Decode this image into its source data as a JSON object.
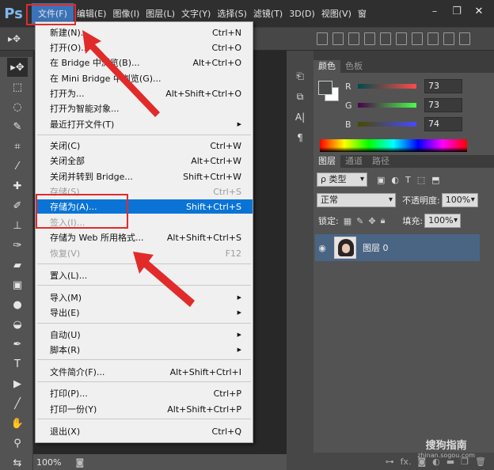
{
  "app": {
    "logo": "Ps"
  },
  "menubar": {
    "items": [
      "文件(F)",
      "编辑(E)",
      "图像(I)",
      "图层(L)",
      "文字(Y)",
      "选择(S)",
      "滤镜(T)",
      "3D(D)",
      "视图(V)",
      "窗"
    ]
  },
  "file_menu": {
    "items": [
      {
        "label": "新建(N)...",
        "shortcut": "Ctrl+N"
      },
      {
        "label": "打开(O)...",
        "shortcut": "Ctrl+O"
      },
      {
        "label": "在 Bridge 中浏览(B)...",
        "shortcut": "Alt+Ctrl+O"
      },
      {
        "label": "在 Mini Bridge 中浏览(G)...",
        "shortcut": ""
      },
      {
        "label": "打开为...",
        "shortcut": "Alt+Shift+Ctrl+O"
      },
      {
        "label": "打开为智能对象...",
        "shortcut": ""
      },
      {
        "label": "最近打开文件(T)",
        "shortcut": ""
      },
      {
        "label": "关闭(C)",
        "shortcut": "Ctrl+W"
      },
      {
        "label": "关闭全部",
        "shortcut": "Alt+Ctrl+W"
      },
      {
        "label": "关闭并转到 Bridge...",
        "shortcut": "Shift+Ctrl+W"
      },
      {
        "label": "存储(S)",
        "shortcut": "Ctrl+S"
      },
      {
        "label": "存储为(A)...",
        "shortcut": "Shift+Ctrl+S"
      },
      {
        "label": "签入(I)...",
        "shortcut": ""
      },
      {
        "label": "存储为 Web 所用格式...",
        "shortcut": "Alt+Shift+Ctrl+S"
      },
      {
        "label": "恢复(V)",
        "shortcut": "F12"
      },
      {
        "label": "置入(L)...",
        "shortcut": ""
      },
      {
        "label": "导入(M)",
        "shortcut": ""
      },
      {
        "label": "导出(E)",
        "shortcut": ""
      },
      {
        "label": "自动(U)",
        "shortcut": ""
      },
      {
        "label": "脚本(R)",
        "shortcut": ""
      },
      {
        "label": "文件简介(F)...",
        "shortcut": "Alt+Shift+Ctrl+I"
      },
      {
        "label": "打印(P)...",
        "shortcut": "Ctrl+P"
      },
      {
        "label": "打印一份(Y)",
        "shortcut": "Alt+Shift+Ctrl+P"
      },
      {
        "label": "退出(X)",
        "shortcut": "Ctrl+Q"
      }
    ]
  },
  "color_panel": {
    "tabs": [
      "颜色",
      "色板"
    ],
    "r_label": "R",
    "g_label": "G",
    "b_label": "B",
    "r_value": "73",
    "g_value": "73",
    "b_value": "74"
  },
  "layers_panel": {
    "tabs": [
      "图层",
      "通道",
      "路径"
    ],
    "filter_label": "ρ 类型",
    "blend_mode": "正常",
    "opacity_label": "不透明度:",
    "opacity_value": "100%",
    "lock_label": "锁定:",
    "fill_label": "填充:",
    "fill_value": "100%",
    "layer_name": "图层 0",
    "bottom_icons": [
      "link-icon",
      "fx-icon",
      "mask-icon",
      "adjustment-icon",
      "folder-icon",
      "new-layer-icon",
      "trash-icon"
    ],
    "fx_label": "fx."
  },
  "status": {
    "zoom": "100%"
  },
  "watermark": {
    "main": "搜狗指南",
    "sub": "zhinan.sogou.com"
  }
}
